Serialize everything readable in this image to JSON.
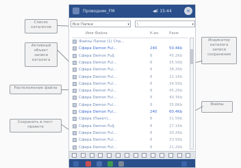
{
  "window": {
    "title": "Проводник_FM",
    "status": "◀€ 15:44",
    "close_label": "×"
  },
  "filters": {
    "left_value": "Все Папки",
    "right_value": "\\"
  },
  "list": {
    "header": {
      "name": "Имя Файла",
      "mid": "К-во",
      "size": "Разм"
    },
    "rows": [
      {
        "name": "Файлы Папки (1) Cha...",
        "mid": "",
        "size": "",
        "highlight": false
      },
      {
        "name": "Сфера Demon Ful...",
        "mid": "240",
        "size": "50.4Kb",
        "highlight": true
      },
      {
        "name": "Сфера Demon FulJ.",
        "mid": "8",
        "size": "45.2Kb",
        "highlight": false
      },
      {
        "name": "Сфера Demon Ful...",
        "mid": "8",
        "size": "35.5Kb",
        "highlight": false
      },
      {
        "name": "Сфера Demon Ful...",
        "mid": "8",
        "size": "38.2Kb",
        "highlight": false
      },
      {
        "name": "Сфера Demon Ful...",
        "mid": "8",
        "size": "22.1Kb",
        "highlight": false
      },
      {
        "name": "Сфера Demon Ful...",
        "mid": "8",
        "size": "34.5Kb",
        "highlight": false
      },
      {
        "name": "Сфера Demon Ful...",
        "mid": "8",
        "size": "45.2Kb",
        "highlight": false
      },
      {
        "name": "Сфера Demon Ful...",
        "mid": "8",
        "size": "40.3Kb",
        "highlight": false
      },
      {
        "name": "Сфера Demon Ful...",
        "mid": "8",
        "size": "35.8Kb",
        "highlight": false
      },
      {
        "name": "Сфера Demon Ful...",
        "mid": "240",
        "size": "60.4Kb",
        "highlight": true
      },
      {
        "name": "Сфера (Пакет)...",
        "mid": "8",
        "size": "31.5Kb",
        "highlight": false
      },
      {
        "name": "Сфера Demon FulJ.",
        "mid": "8",
        "size": "27.1Kb",
        "highlight": false
      },
      {
        "name": "Сфера Demon Ful...",
        "mid": "8",
        "size": "30.2Kb",
        "highlight": false
      },
      {
        "name": "Сфера Demon Ful...",
        "mid": "8",
        "size": "33.5Kb",
        "highlight": false
      },
      {
        "name": "Сфера Demon Ful...",
        "mid": "8",
        "size": "21.2Kb",
        "highlight": false
      }
    ]
  },
  "callouts": [
    {
      "id": "callout-top-left",
      "text": "Список каталогов"
    },
    {
      "id": "callout-upper-left",
      "text": "Активный объект записи каталога"
    },
    {
      "id": "callout-middle-left",
      "text": "Расположение файла"
    },
    {
      "id": "callout-lower-left",
      "text": "Сохранить в пост-проекте"
    },
    {
      "id": "callout-right",
      "text": "Индикатор каталога записи сохранения"
    },
    {
      "id": "callout-lower-right",
      "text": "Файлы"
    }
  ],
  "colors": {
    "accent": "#2a4f8a",
    "highlight_text": "#3b6bd6",
    "callout_border": "#9aa0a6"
  }
}
